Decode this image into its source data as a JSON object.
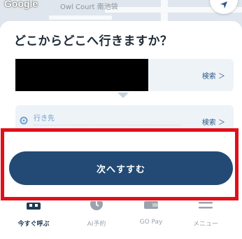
{
  "map": {
    "logo": "Google",
    "place": "Owl Court 南池袋"
  },
  "heading": "どこからどこへ行きますか？",
  "origin": {
    "search_label": "検索 ＞"
  },
  "destination": {
    "label": "行き先",
    "search_label": "検索 ＞"
  },
  "cta": {
    "label": "次へすすむ"
  },
  "nav": {
    "items": [
      {
        "label": "今すぐ呼ぶ",
        "icon": "taxi-icon"
      },
      {
        "label": "AI予約",
        "icon": "clock-icon"
      },
      {
        "label": "GO Pay",
        "icon": "wallet-icon"
      },
      {
        "label": "メニュー",
        "icon": "menu-icon"
      }
    ]
  },
  "colors": {
    "accent": "#224a74",
    "highlight": "#e0101b",
    "link": "#2e5a86"
  }
}
